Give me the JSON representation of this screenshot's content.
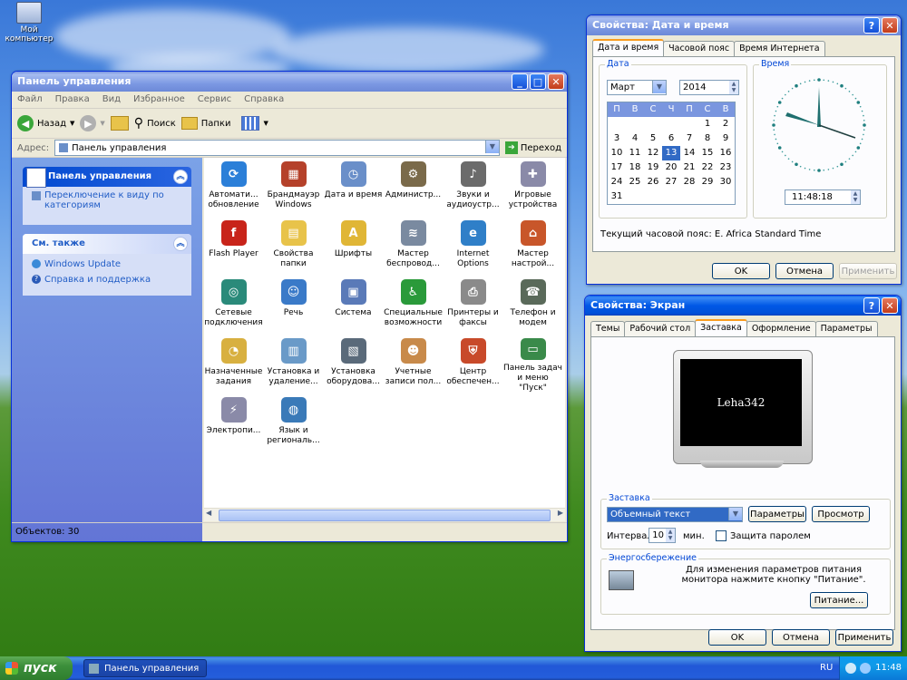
{
  "desktop": {
    "my_computer_label": "Мой\nкомпьютер"
  },
  "control_panel": {
    "title": "Панель управления",
    "menu": [
      "Файл",
      "Правка",
      "Вид",
      "Избранное",
      "Сервис",
      "Справка"
    ],
    "toolbar": {
      "back": "Назад",
      "search": "Поиск",
      "folders": "Папки"
    },
    "address_label": "Адрес:",
    "address_value": "Панель управления",
    "go_label": "Переход",
    "taskpane": {
      "box1_title": "Панель управления",
      "switch_link": "Переключение к виду по категориям",
      "box2_title": "См. также",
      "links": [
        "Windows Update",
        "Справка и поддержка"
      ]
    },
    "items": [
      {
        "label": "Автомати... обновление",
        "color": "#2b7fd8",
        "glyph": "⟳"
      },
      {
        "label": "Брандмауэр Windows",
        "color": "#b5412a",
        "glyph": "▦"
      },
      {
        "label": "Дата и время",
        "color": "#6a8fc9",
        "glyph": "◷"
      },
      {
        "label": "Администр...",
        "color": "#7a6a4a",
        "glyph": "⚙"
      },
      {
        "label": "Звуки и аудиоустр...",
        "color": "#6b6b6b",
        "glyph": "♪"
      },
      {
        "label": "Игровые устройства",
        "color": "#8a8aa8",
        "glyph": "✚"
      },
      {
        "label": "Flash Player",
        "color": "#c8241a",
        "glyph": "f"
      },
      {
        "label": "Свойства папки",
        "color": "#e8c34a",
        "glyph": "▤"
      },
      {
        "label": "Шрифты",
        "color": "#e0b636",
        "glyph": "A"
      },
      {
        "label": "Мастер беспровод...",
        "color": "#7a8aa0",
        "glyph": "≋"
      },
      {
        "label": "Internet Options",
        "color": "#2f7fc8",
        "glyph": "e"
      },
      {
        "label": "Мастер настрой...",
        "color": "#c8562a",
        "glyph": "⌂"
      },
      {
        "label": "Сетевые подключения",
        "color": "#2a8a7a",
        "glyph": "◎"
      },
      {
        "label": "Речь",
        "color": "#3a7ac8",
        "glyph": "☺"
      },
      {
        "label": "Система",
        "color": "#5a7ab8",
        "glyph": "▣"
      },
      {
        "label": "Специальные возможности",
        "color": "#2a9a3a",
        "glyph": "♿"
      },
      {
        "label": "Принтеры и факсы",
        "color": "#8a8a8a",
        "glyph": "⎙"
      },
      {
        "label": "Телефон и модем",
        "color": "#5a6a5a",
        "glyph": "☎"
      },
      {
        "label": "Назначенные задания",
        "color": "#d8b040",
        "glyph": "◔"
      },
      {
        "label": "Установка и удаление...",
        "color": "#6a9ac8",
        "glyph": "▥"
      },
      {
        "label": "Установка оборудова...",
        "color": "#5a6a7a",
        "glyph": "▧"
      },
      {
        "label": "Учетные записи пол...",
        "color": "#c88a4a",
        "glyph": "☻"
      },
      {
        "label": "Центр обеспечен...",
        "color": "#c84a2a",
        "glyph": "⛨"
      },
      {
        "label": "Панель задач и меню \"Пуск\"",
        "color": "#3a8a4a",
        "glyph": "▭"
      },
      {
        "label": "Электропи...",
        "color": "#8a8aa8",
        "glyph": "⚡"
      },
      {
        "label": "Язык и региональ...",
        "color": "#3a7ab8",
        "glyph": "◍"
      }
    ],
    "status": "Объектов: 30"
  },
  "datetime": {
    "title": "Свойства: Дата и время",
    "tabs": [
      "Дата и время",
      "Часовой пояс",
      "Время Интернета"
    ],
    "date_group": "Дата",
    "month": "Март",
    "year": "2014",
    "weekdays": [
      "П",
      "В",
      "С",
      "Ч",
      "П",
      "С",
      "В"
    ],
    "weeks": [
      [
        "",
        "",
        "",
        "",
        "",
        "1",
        "2"
      ],
      [
        "3",
        "4",
        "5",
        "6",
        "7",
        "8",
        "9"
      ],
      [
        "10",
        "11",
        "12",
        "13",
        "14",
        "15",
        "16"
      ],
      [
        "17",
        "18",
        "19",
        "20",
        "21",
        "22",
        "23"
      ],
      [
        "24",
        "25",
        "26",
        "27",
        "28",
        "29",
        "30"
      ],
      [
        "31",
        "",
        "",
        "",
        "",
        "",
        ""
      ]
    ],
    "selected_day": "13",
    "time_group": "Время",
    "time": "11:48:18",
    "timezone": "Текущий часовой пояс: E. Africa Standard Time",
    "buttons": {
      "ok": "OK",
      "cancel": "Отмена",
      "apply": "Применить"
    }
  },
  "display": {
    "title": "Свойства: Экран",
    "tabs": [
      "Темы",
      "Рабочий стол",
      "Заставка",
      "Оформление",
      "Параметры"
    ],
    "preview_text": "Leha342",
    "saver_group": "Заставка",
    "saver_value": "Объемный текст",
    "settings_btn": "Параметры",
    "preview_btn": "Просмотр",
    "interval_label": "Интервал:",
    "interval_value": "10",
    "minutes_label": "мин.",
    "password_label": "Защита паролем",
    "power_group": "Энергосбережение",
    "power_text": "Для изменения параметров питания монитора нажмите кнопку \"Питание\".",
    "power_btn": "Питание...",
    "buttons": {
      "ok": "OK",
      "cancel": "Отмена",
      "apply": "Применить"
    }
  },
  "taskbar": {
    "start": "пуск",
    "task": "Панель управления",
    "lang": "RU",
    "clock": "11:48"
  }
}
